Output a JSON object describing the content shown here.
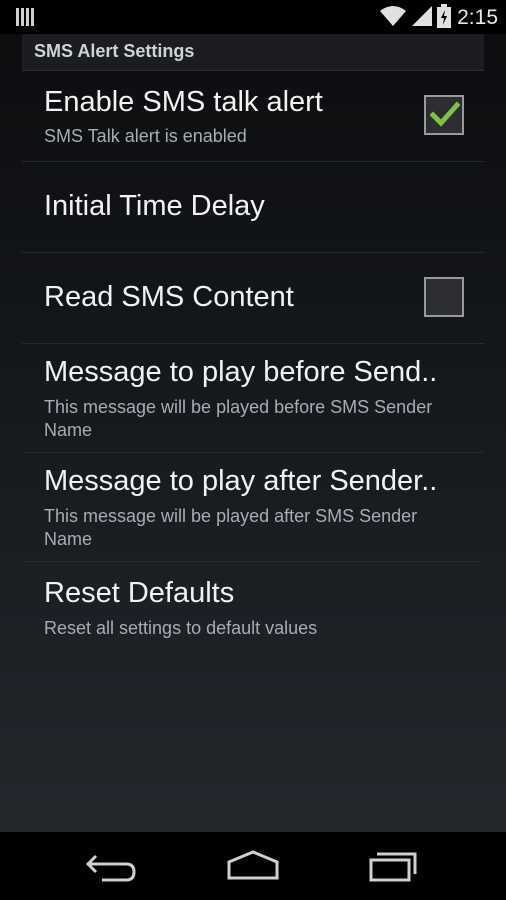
{
  "status_bar": {
    "time": "2:15",
    "icons": [
      "notification-icon",
      "wifi-icon",
      "signal-icon",
      "battery-icon"
    ]
  },
  "header": {
    "title": "SMS Alert Settings"
  },
  "preferences": [
    {
      "title": "Enable SMS talk alert",
      "summary": "SMS Talk alert is enabled",
      "checkbox": true,
      "checked": true
    },
    {
      "title": "Initial Time Delay",
      "summary": "",
      "checkbox": false
    },
    {
      "title": "Read SMS Content",
      "summary": "",
      "checkbox": true,
      "checked": false
    },
    {
      "title": "Message to play before Send..",
      "summary": "This message will be played before SMS Sender Name",
      "checkbox": false
    },
    {
      "title": "Message to play after Sender..",
      "summary": "This message will be played after SMS Sender Name",
      "checkbox": false
    },
    {
      "title": "Reset Defaults",
      "summary": "Reset all settings to default values",
      "checkbox": false
    }
  ],
  "nav_bar": {
    "buttons": [
      "back-icon",
      "home-icon",
      "recent-apps-icon"
    ]
  },
  "colors": {
    "checkmark": "#7ec440",
    "accent": "#33b5e5"
  }
}
